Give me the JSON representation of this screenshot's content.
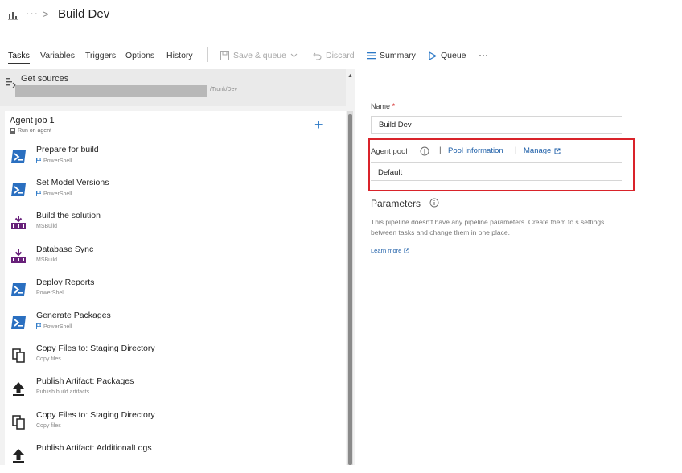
{
  "header": {
    "more": "···",
    "chevron": ">",
    "title": "Build Dev"
  },
  "tabs": [
    {
      "label": "Tasks",
      "active": true
    },
    {
      "label": "Variables"
    },
    {
      "label": "Triggers"
    },
    {
      "label": "Options"
    },
    {
      "label": "History"
    }
  ],
  "toolbar": {
    "save_queue": "Save & queue",
    "discard": "Discard",
    "summary": "Summary",
    "queue": "Queue",
    "more": "···"
  },
  "get_sources": {
    "title": "Get sources",
    "path": "/Trunk/Dev"
  },
  "agent_job": {
    "title": "Agent job 1",
    "subtitle": "Run on agent",
    "add": "+"
  },
  "tasks": [
    {
      "name": "Prepare for build",
      "sub": "PowerShell",
      "icon": "powershell-icon",
      "flag": true
    },
    {
      "name": "Set Model Versions",
      "sub": "PowerShell",
      "icon": "powershell-icon",
      "flag": true
    },
    {
      "name": "Build the solution",
      "sub": "MSBuild",
      "icon": "msbuild-icon",
      "flag": false
    },
    {
      "name": "Database Sync",
      "sub": "MSBuild",
      "icon": "msbuild-icon",
      "flag": false
    },
    {
      "name": "Deploy Reports",
      "sub": "PowerShell",
      "icon": "powershell-icon",
      "flag": false
    },
    {
      "name": "Generate Packages",
      "sub": "PowerShell",
      "icon": "powershell-icon",
      "flag": true
    },
    {
      "name": "Copy Files to: Staging Directory",
      "sub": "Copy files",
      "icon": "copy-files-icon",
      "flag": false
    },
    {
      "name": "Publish Artifact: Packages",
      "sub": "Publish build artifacts",
      "icon": "publish-artifact-icon",
      "flag": false
    },
    {
      "name": "Copy Files to: Staging Directory",
      "sub": "Copy files",
      "icon": "copy-files-icon",
      "flag": false
    },
    {
      "name": "Publish Artifact: AdditionalLogs",
      "sub": "",
      "icon": "publish-artifact-icon",
      "flag": false
    }
  ],
  "details": {
    "name_label": "Name",
    "required_mark": "*",
    "name_value": "Build Dev",
    "agent_pool_label": "Agent pool",
    "separator": "|",
    "pool_info_link": "Pool information",
    "manage_link": "Manage",
    "agent_pool_value": "Default",
    "parameters_title": "Parameters",
    "parameters_desc": "This pipeline doesn't have any pipeline parameters. Create them to s settings between tasks and change them in one place.",
    "learn_more": "Learn more"
  },
  "colors": {
    "accent": "#2b78c6",
    "link": "#1e5fa8",
    "highlight_border": "#d9232a",
    "powershell": "#2a6fc0",
    "msbuild": "#68217a"
  }
}
